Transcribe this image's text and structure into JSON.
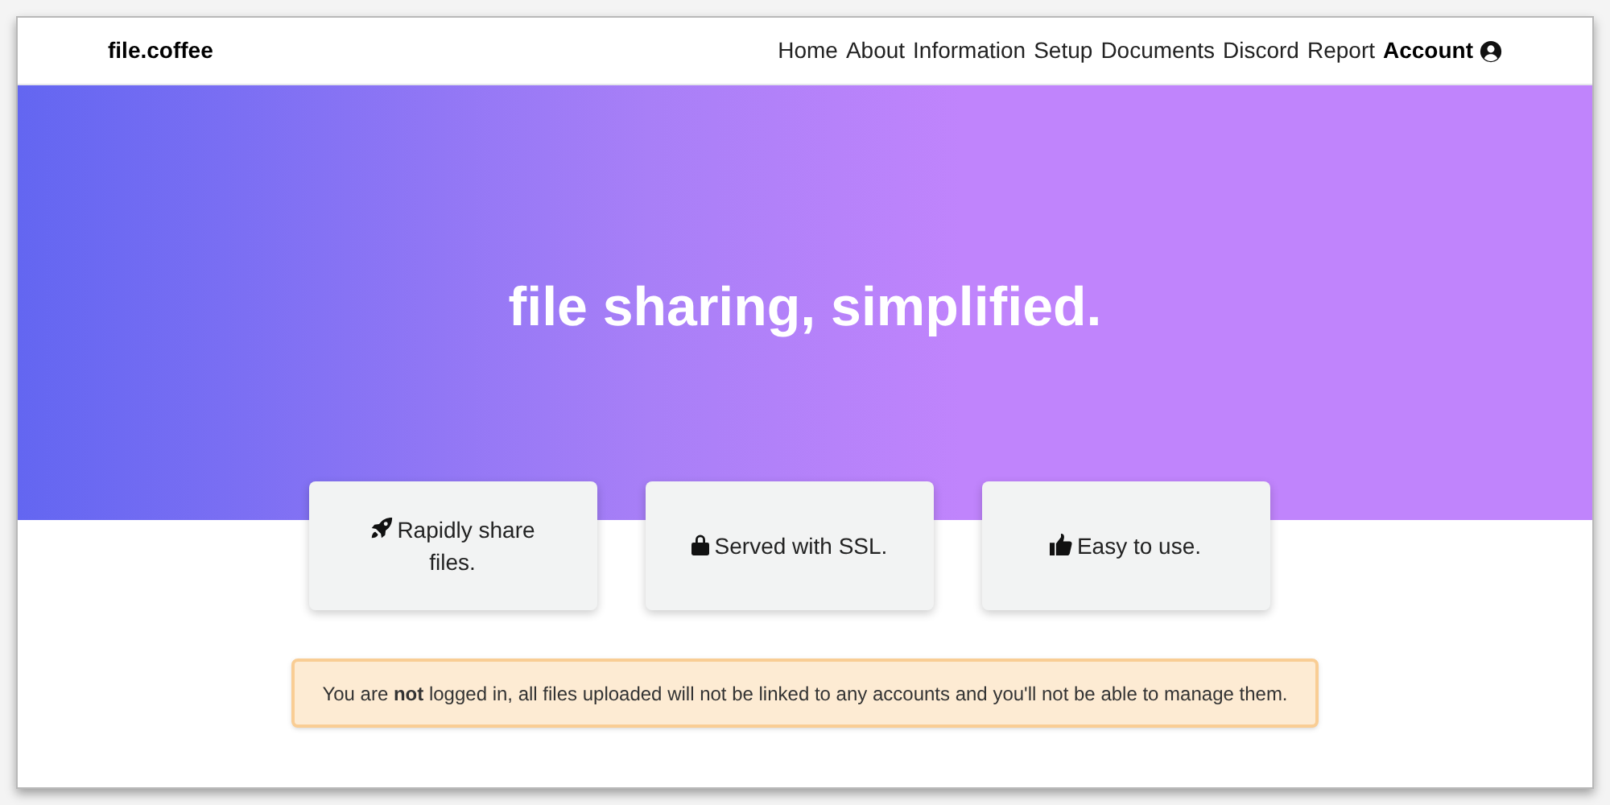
{
  "navbar": {
    "brand": "file.coffee",
    "links": [
      {
        "label": "Home",
        "kind": "link"
      },
      {
        "label": "About",
        "kind": "link"
      },
      {
        "label": "Information",
        "kind": "link"
      },
      {
        "label": "Setup",
        "kind": "link"
      },
      {
        "label": "Documents",
        "kind": "link"
      },
      {
        "label": "Discord",
        "kind": "link"
      },
      {
        "label": "Report",
        "kind": "link"
      },
      {
        "label": "Account",
        "kind": "account"
      }
    ]
  },
  "hero": {
    "title": "file sharing, simplified."
  },
  "features": [
    {
      "text": "Rapidly share files."
    },
    {
      "text": "Served with SSL."
    },
    {
      "text": "Easy to use."
    }
  ],
  "alert": {
    "text": "You are **not** logged in, all files uploaded will not be linked to any accounts and you'll not be able to manage them."
  }
}
